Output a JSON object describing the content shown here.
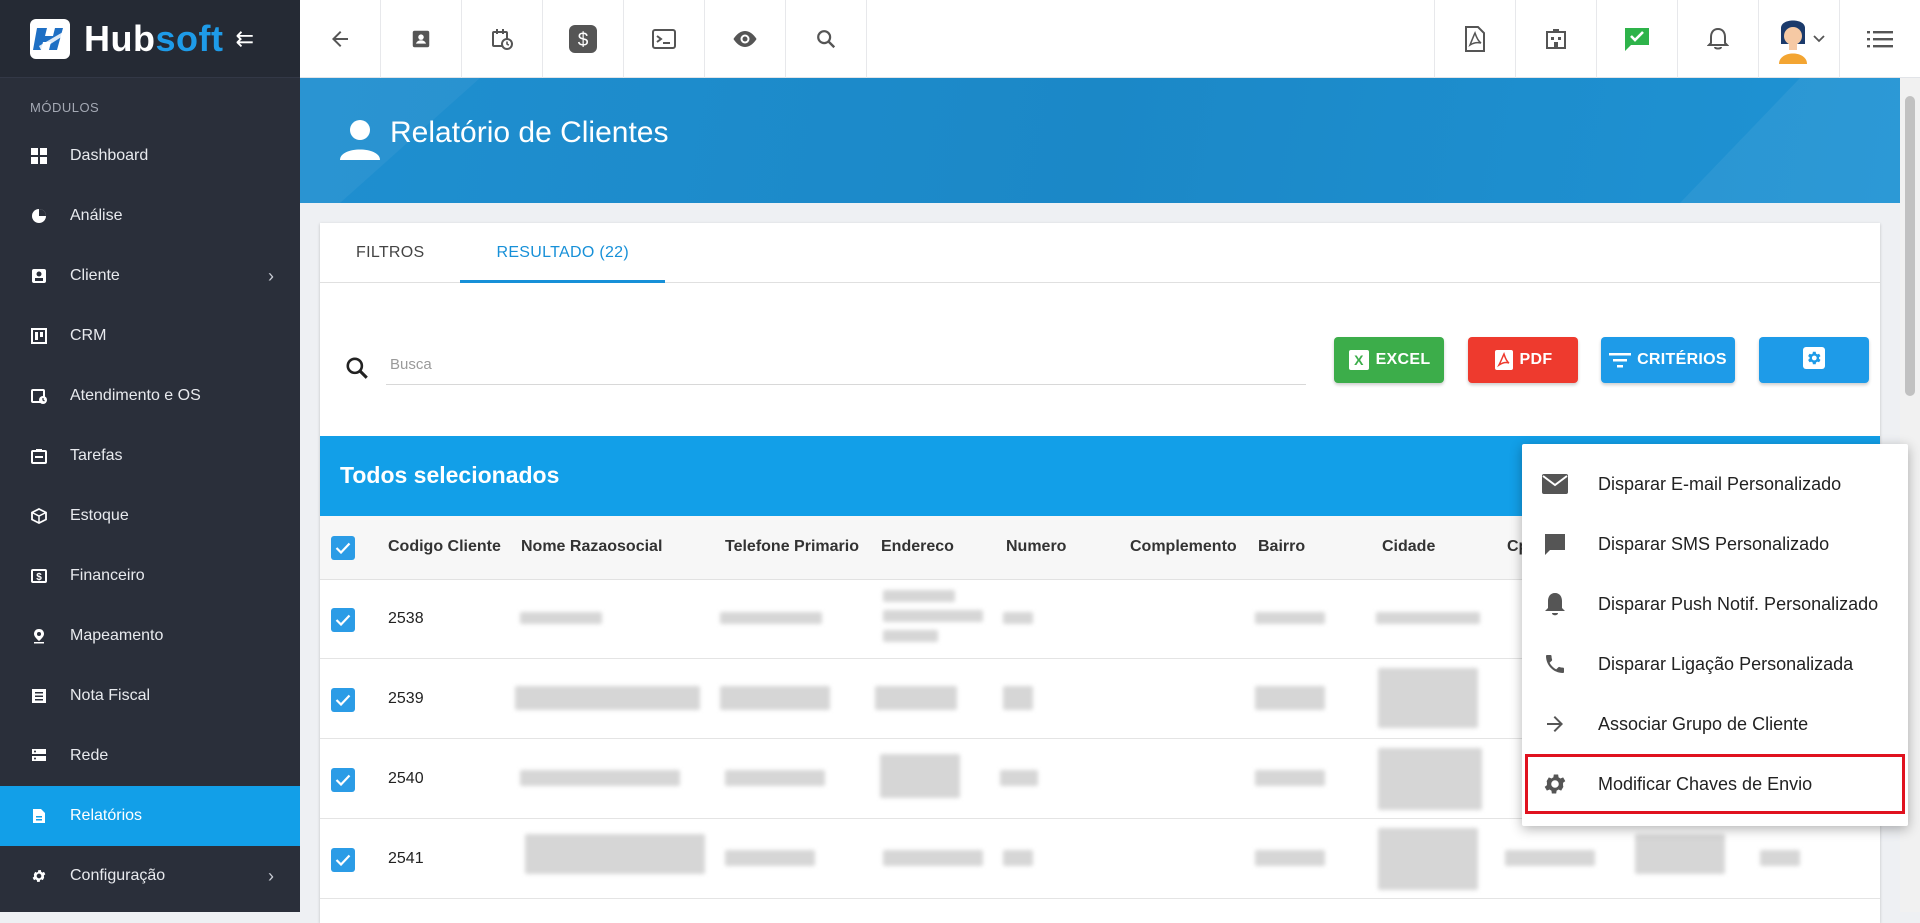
{
  "brand": {
    "name_part1": "Hub",
    "name_part2": "soft",
    "collapse_glyph": "⇇"
  },
  "sidebar": {
    "section_label": "MÓDULOS",
    "items": [
      {
        "label": "Dashboard",
        "icon": "dashboard-icon"
      },
      {
        "label": "Análise",
        "icon": "pie-chart-icon"
      },
      {
        "label": "Cliente",
        "icon": "contact-card-icon",
        "has_arrow": true
      },
      {
        "label": "CRM",
        "icon": "crm-board-icon"
      },
      {
        "label": "Atendimento e OS",
        "icon": "calendar-clock-icon"
      },
      {
        "label": "Tarefas",
        "icon": "tasks-icon"
      },
      {
        "label": "Estoque",
        "icon": "box-icon"
      },
      {
        "label": "Financeiro",
        "icon": "money-icon"
      },
      {
        "label": "Mapeamento",
        "icon": "map-pin-icon"
      },
      {
        "label": "Nota Fiscal",
        "icon": "invoice-icon"
      },
      {
        "label": "Rede",
        "icon": "server-icon"
      },
      {
        "label": "Relatórios",
        "icon": "report-icon",
        "active": true
      },
      {
        "label": "Configuração",
        "icon": "gear-icon",
        "has_arrow": true
      }
    ],
    "arrow_glyph": "›"
  },
  "header": {
    "title": "Relatório de Clientes"
  },
  "tabs": [
    {
      "label": "FILTROS"
    },
    {
      "label": "RESULTADO (22)",
      "active": true
    }
  ],
  "search": {
    "placeholder": "Busca"
  },
  "buttons": {
    "excel": "EXCEL",
    "pdf": "PDF",
    "criterios": "CRITÉRIOS"
  },
  "selection_bar": {
    "text": "Todos selecionados"
  },
  "table": {
    "columns": [
      "Codigo Cliente",
      "Nome Razaosocial",
      "Telefone Primario",
      "Endereco",
      "Numero",
      "Complemento",
      "Bairro",
      "Cidade",
      "Cp"
    ],
    "rows": [
      {
        "code": "2538"
      },
      {
        "code": "2539"
      },
      {
        "code": "2540"
      },
      {
        "code": "2541"
      }
    ]
  },
  "dropdown": {
    "items": [
      {
        "label": "Disparar E-mail Personalizado",
        "icon": "email-icon"
      },
      {
        "label": "Disparar SMS Personalizado",
        "icon": "sms-icon"
      },
      {
        "label": "Disparar Push Notif. Personalizado",
        "icon": "bell-icon"
      },
      {
        "label": "Disparar Ligação Personalizada",
        "icon": "phone-icon"
      },
      {
        "label": "Associar Grupo de Cliente",
        "icon": "arrow-right-icon"
      },
      {
        "label": "Modificar Chaves de Envio",
        "icon": "gear-icon",
        "highlighted": true
      }
    ]
  },
  "colors": {
    "accent": "#129fe8",
    "sidebar_bg": "#2a2f3a",
    "excel": "#3cad4a",
    "pdf": "#ee3a2e",
    "highlight_border": "#e0121f"
  }
}
